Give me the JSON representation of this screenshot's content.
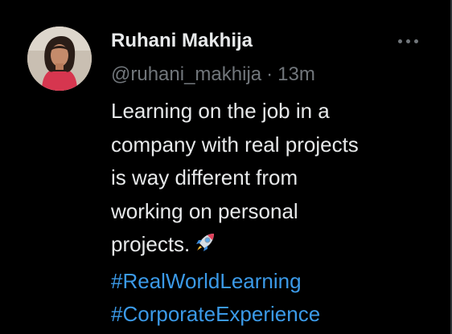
{
  "tweet": {
    "author_name": "Ruhani Makhija",
    "handle": "@ruhani_makhija",
    "separator": "·",
    "timestamp": "13m",
    "more_icon": "ellipsis-horizontal-icon",
    "avatar_icon": "profile-photo",
    "text_lines": [
      "Learning on the job in a",
      "company with real projects",
      "is way different from",
      "working on personal",
      "projects."
    ],
    "emoji": "rocket",
    "hashtags": [
      "#RealWorldLearning",
      "#CorporateExperience"
    ]
  },
  "colors": {
    "background": "#000000",
    "text_primary": "#e7e9ea",
    "text_secondary": "#71767b",
    "hashtag": "#3b9ae8"
  }
}
